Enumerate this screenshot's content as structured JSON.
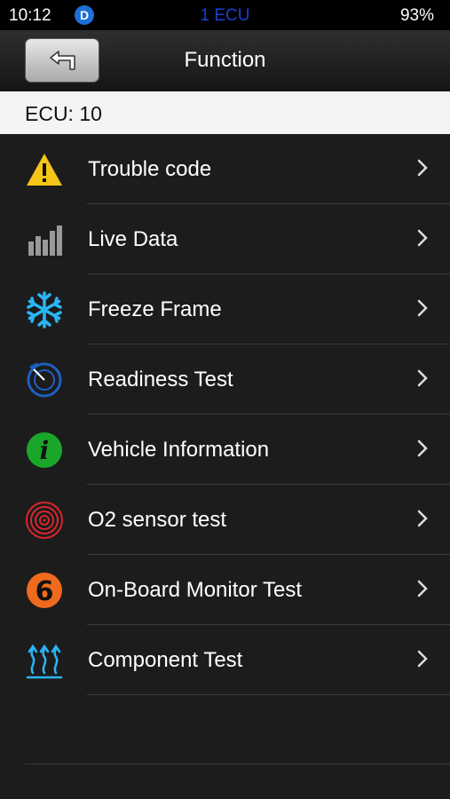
{
  "status_bar": {
    "time": "10:12",
    "badge": "D",
    "ecu_count": "1 ECU",
    "battery": "93%"
  },
  "nav": {
    "title": "Function",
    "back_icon": "back-arrow-icon"
  },
  "ecu_header": "ECU: 10",
  "colors": {
    "background": "#1c1c1c",
    "accent_blue": "#1e6fd6",
    "warning_yellow": "#f5c518",
    "info_green": "#1aa62a",
    "sensor_red": "#d8262c",
    "monitor_orange": "#f06a1e"
  },
  "menu": [
    {
      "label": "Trouble code",
      "icon": "warning-icon"
    },
    {
      "label": "Live Data",
      "icon": "bar-chart-icon"
    },
    {
      "label": "Freeze Frame",
      "icon": "snowflake-icon"
    },
    {
      "label": "Readiness Test",
      "icon": "gauge-icon"
    },
    {
      "label": "Vehicle Information",
      "icon": "info-icon"
    },
    {
      "label": "O2 sensor test",
      "icon": "target-icon"
    },
    {
      "label": "On-Board Monitor Test",
      "icon": "number-six-icon"
    },
    {
      "label": "Component Test",
      "icon": "heat-waves-icon"
    }
  ]
}
